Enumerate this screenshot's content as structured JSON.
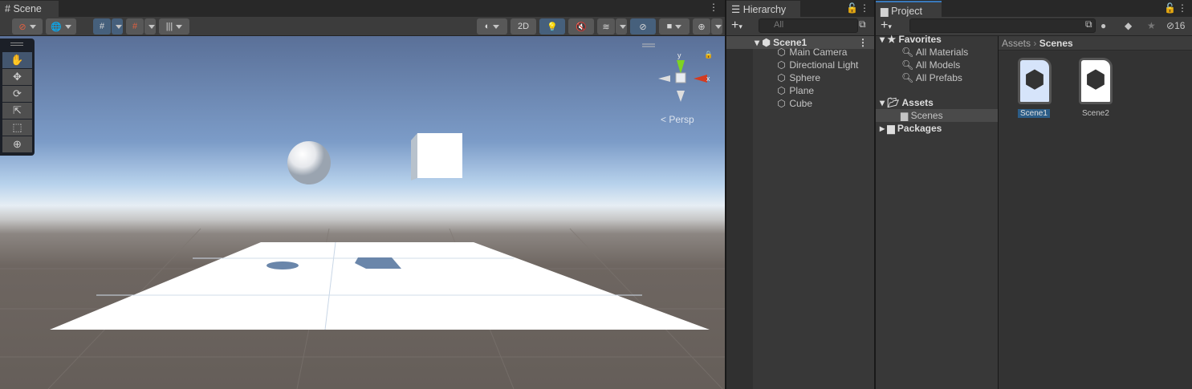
{
  "scene": {
    "tab": "Scene",
    "btn_2d": "2D",
    "persp": "Persp",
    "axis_x": "x",
    "axis_y": "y"
  },
  "hierarchy": {
    "tab": "Hierarchy",
    "search_placeholder": "All",
    "root": "Scene1",
    "items": [
      "Main Camera",
      "Directional Light",
      "Sphere",
      "Plane",
      "Cube"
    ]
  },
  "project": {
    "tab": "Project",
    "hidden_count": "16",
    "favorites": "Favorites",
    "fav_items": [
      "All Materials",
      "All Models",
      "All Prefabs"
    ],
    "assets": "Assets",
    "scenes": "Scenes",
    "packages": "Packages",
    "breadcrumb": [
      "Assets",
      "Scenes"
    ],
    "files": [
      "Scene1",
      "Scene2"
    ]
  },
  "colors": {
    "accent": "#46607c",
    "selection": "#2c5d87"
  }
}
